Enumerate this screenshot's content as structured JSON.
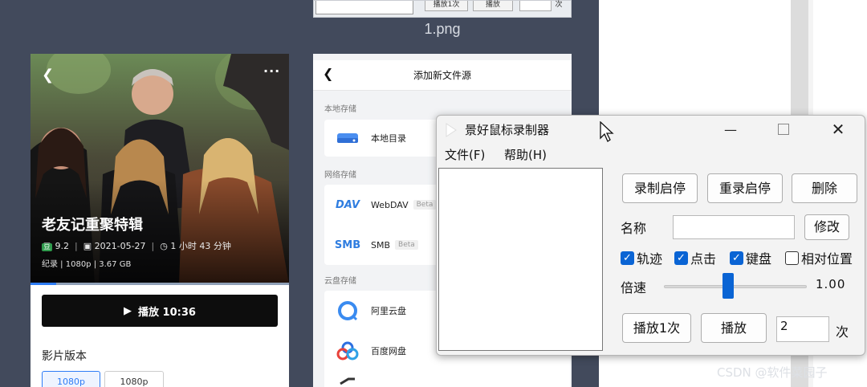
{
  "previous_preview": {
    "buttons": [
      "播放1次",
      "播放"
    ],
    "count_suffix": "次",
    "file_label": "1.png"
  },
  "movie_app": {
    "title": "老友记重聚特辑",
    "rating_badge": "豆",
    "rating": "9.2",
    "date": "2021-05-27",
    "duration": "1 小时 43 分钟",
    "meta_line": "纪录 | 1080p | 3.67 GB",
    "play_label": "播放 10:36",
    "version_heading": "影片版本",
    "versions": [
      "1080p",
      "1080p"
    ],
    "progress": 0.1,
    "back_icon": "chevron-left-icon",
    "more_icon": "more-icon"
  },
  "file_source": {
    "header_title": "添加新文件源",
    "local_section": "本地存储",
    "local_item": "本地目录",
    "network_section": "网络存储",
    "network_items": [
      {
        "name": "WebDAV",
        "badge": "Beta",
        "icon_text": "DAV"
      },
      {
        "name": "SMB",
        "badge": "Beta",
        "icon_text": "SMB"
      }
    ],
    "cloud_section": "云盘存储",
    "cloud_items": [
      "阿里云盘",
      "百度网盘"
    ]
  },
  "recorder": {
    "title": "景好鼠标录制器",
    "menu": [
      "文件(F)",
      "帮助(H)"
    ],
    "buttons": {
      "record": "录制启停",
      "rerecord": "重录启停",
      "delete": "删除",
      "modify": "修改",
      "play_once": "播放1次",
      "play": "播放"
    },
    "name_label": "名称",
    "name_value": "",
    "checkboxes": [
      {
        "label": "轨迹",
        "checked": true
      },
      {
        "label": "点击",
        "checked": true
      },
      {
        "label": "键盘",
        "checked": true
      },
      {
        "label": "相对位置",
        "checked": false
      }
    ],
    "speed_label": "倍速",
    "speed_value": "1.00",
    "speed_fraction": 0.45,
    "play_count": "2",
    "count_suffix": "次"
  },
  "watermark": "CSDN @软件菜园子",
  "colors": {
    "accent": "#0a64d4",
    "dark_bg": "#424a5c",
    "play_black": "#0d0d0d"
  }
}
